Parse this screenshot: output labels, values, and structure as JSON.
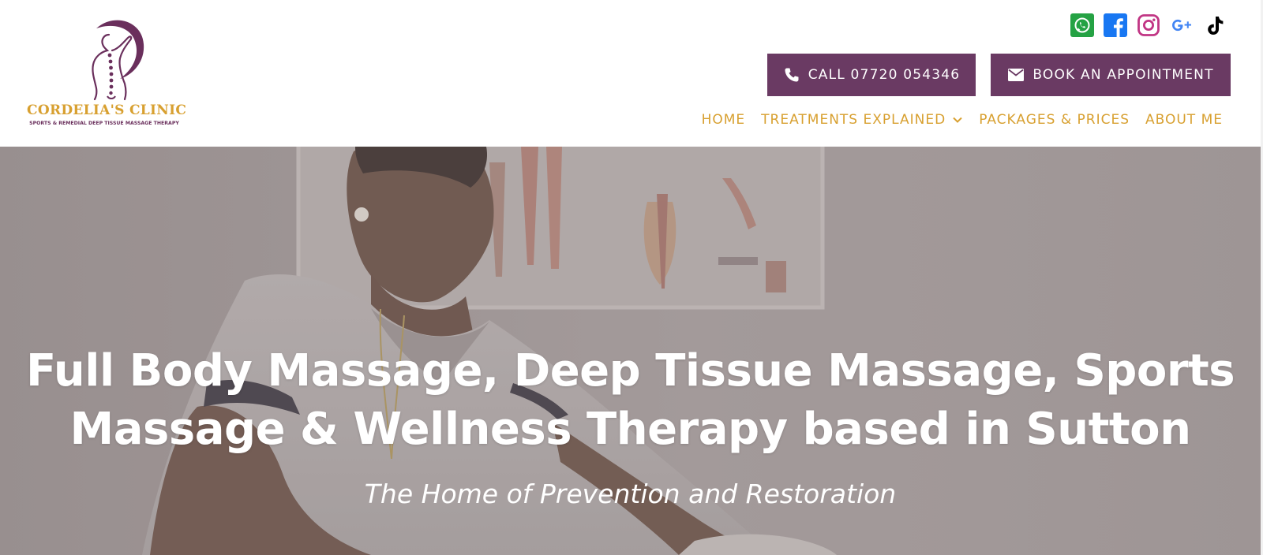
{
  "brand": {
    "name": "CORDELIA'S CLINIC",
    "tagline": "SPORTS & REMEDIAL DEEP TISSUE MASSAGE THERAPY",
    "colors": {
      "purple": "#6a3a63",
      "gold": "#d8a030"
    }
  },
  "socials": [
    {
      "icon": "whatsapp-icon",
      "color": "#25a244"
    },
    {
      "icon": "facebook-icon",
      "color": "#1877f2"
    },
    {
      "icon": "instagram-icon",
      "color": "#c13584"
    },
    {
      "icon": "google-plus-icon",
      "color": "#4285f4"
    },
    {
      "icon": "tiktok-icon",
      "color": "#000000"
    }
  ],
  "cta": {
    "call_label": "CALL 07720 054346",
    "call_icon": "phone-icon",
    "book_label": "BOOK AN APPOINTMENT",
    "book_icon": "envelope-icon"
  },
  "nav": {
    "items": [
      "HOME",
      "TREATMENTS EXPLAINED",
      "PACKAGES & PRICES",
      "ABOUT ME"
    ],
    "dropdown_icon": "chevron-down-icon"
  },
  "hero": {
    "title_line1": "Full Body Massage, Deep Tissue Massage, Sports",
    "title_line2": "Massage & Wellness Therapy based in Sutton",
    "subtitle": "The Home of Prevention and Restoration"
  }
}
